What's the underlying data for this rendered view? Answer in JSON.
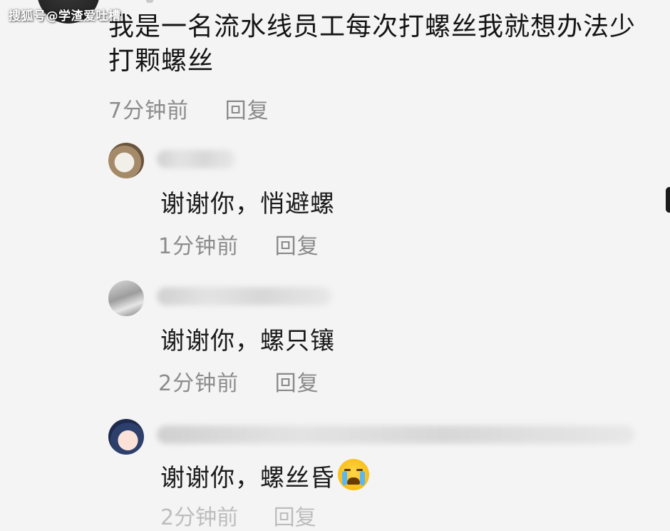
{
  "watermark": "搜狐号@学渣爱吐槽",
  "post": {
    "text": "我是一名流水线员工每次打螺丝我就想办法少打颗螺丝",
    "time": "7分钟前",
    "reply_label": "回复"
  },
  "replies": [
    {
      "text": "谢谢你，悄避螺",
      "time": "1分钟前",
      "reply_label": "回复",
      "avatar": "cat-avatar"
    },
    {
      "text": "谢谢你，螺只镶",
      "time": "2分钟前",
      "reply_label": "回复",
      "avatar": "photo-avatar"
    },
    {
      "text": "谢谢你，螺丝昏",
      "time": "2分钟前",
      "reply_label": "回复",
      "avatar": "anime-avatar",
      "emoji": "loudly-crying-face"
    }
  ]
}
